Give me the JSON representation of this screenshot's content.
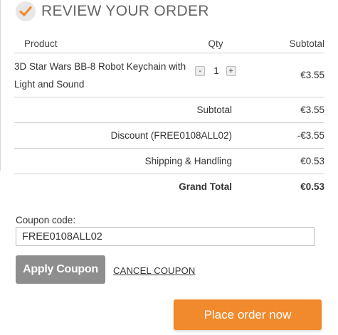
{
  "header": {
    "title": "REVIEW YOUR ORDER",
    "icon": "check-icon",
    "icon_color": "#f08a2c"
  },
  "table": {
    "columns": {
      "product": "Product",
      "qty": "Qty",
      "subtotal": "Subtotal"
    },
    "items": [
      {
        "name": "3D Star Wars BB-8 Robot Keychain with Light and Sound",
        "qty": "1",
        "minus_label": "-",
        "plus_label": "+",
        "subtotal": "€3.55"
      }
    ],
    "totals": [
      {
        "label": "Subtotal",
        "value": "€3.55"
      },
      {
        "label": "Discount (FREE0108ALL02)",
        "value": "-€3.55"
      },
      {
        "label": "Shipping & Handling",
        "value": "€0.53"
      },
      {
        "label": "Grand Total",
        "value": "€0.53"
      }
    ]
  },
  "coupon": {
    "label": "Coupon code:",
    "value": "FREE0108ALL02",
    "apply_label": "Apply Coupon",
    "cancel_label": "CANCEL COUPON"
  },
  "actions": {
    "place_order_label": "Place order now",
    "place_order_color": "#f08a2c"
  }
}
